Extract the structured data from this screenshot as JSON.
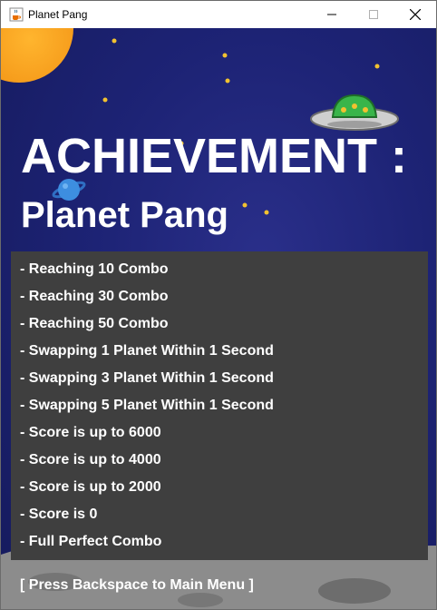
{
  "window": {
    "title": "Planet Pang",
    "icon": "java-cup-icon",
    "controls": [
      "minimize-icon",
      "maximize-icon",
      "close-icon"
    ]
  },
  "screen": {
    "heading": "ACHIEVEMENT :",
    "subheading": "Planet Pang",
    "achievements": [
      "- Reaching 10 Combo",
      "- Reaching 30 Combo",
      "- Reaching 50 Combo",
      "- Swapping 1 Planet Within 1 Second",
      "- Swapping 3 Planet Within 1 Second",
      "- Swapping 5 Planet Within 1 Second",
      "- Score is up to 6000",
      "- Score is up to 4000",
      "- Score is up to 2000",
      "- Score is 0",
      "- Full Perfect Combo"
    ],
    "footer_hint": "[ Press Backspace to Main Menu ]"
  },
  "colors": {
    "sky": "#1d2375",
    "panel": "#3f3f3f",
    "text": "#ffffff",
    "sun": "#f59a1a",
    "star": "#f2c230",
    "ufo_dome": "#39b54a"
  }
}
